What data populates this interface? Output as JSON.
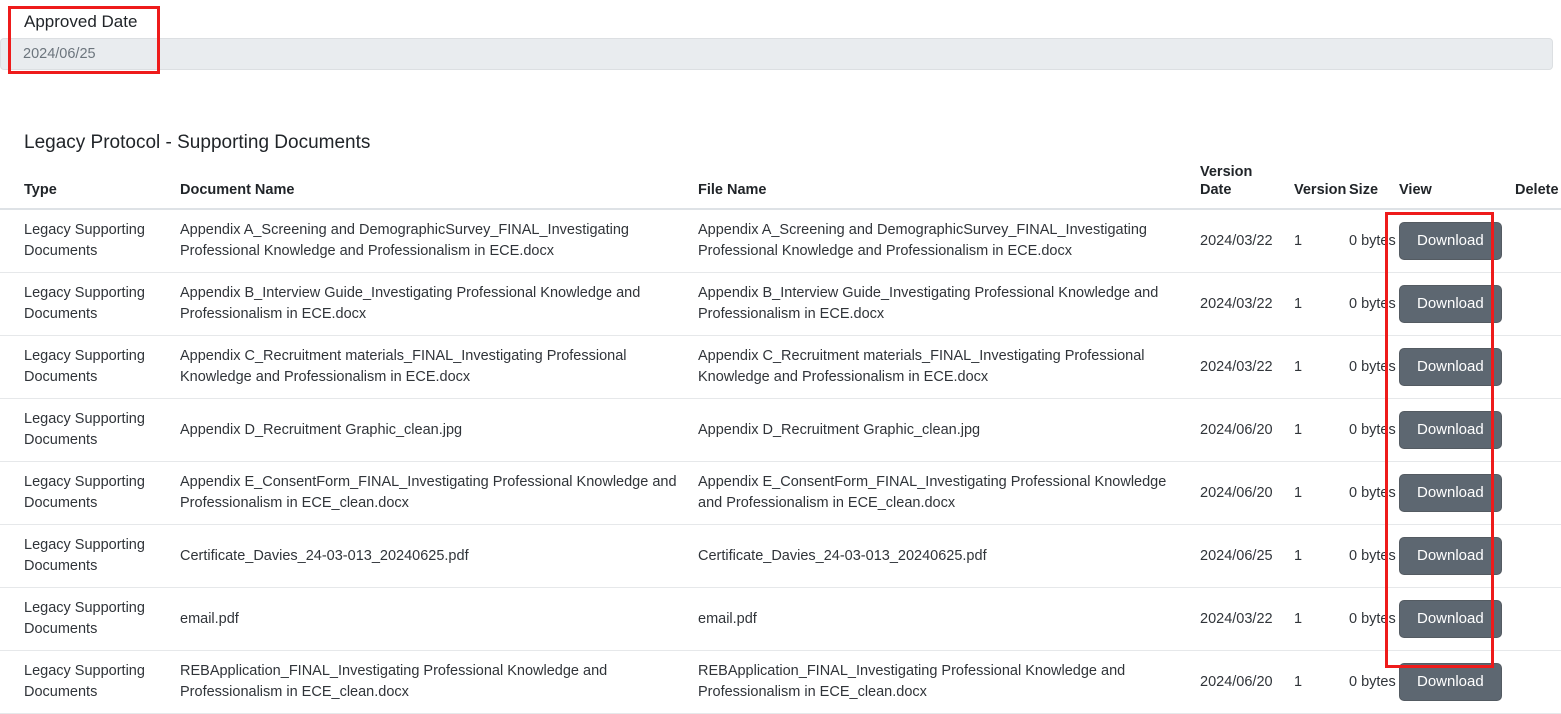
{
  "approved": {
    "label": "Approved Date",
    "value": "2024/06/25"
  },
  "section": {
    "title": "Legacy Protocol - Supporting Documents"
  },
  "table": {
    "headers": {
      "type": "Type",
      "document_name": "Document Name",
      "file_name": "File Name",
      "version_date_line1": "Version",
      "version_date_line2": "Date",
      "version": "Version",
      "size": "Size",
      "view": "View",
      "delete": "Delete"
    },
    "download_label": "Download",
    "rows": [
      {
        "type": "Legacy Supporting Documents",
        "document_name": "Appendix A_Screening and DemographicSurvey_FINAL_Investigating Professional Knowledge and Professionalism in ECE.docx",
        "file_name": "Appendix A_Screening and DemographicSurvey_FINAL_Investigating Professional Knowledge and Professionalism in ECE.docx",
        "version_date": "2024/03/22",
        "version": "1",
        "size": "0 bytes",
        "view": "Download",
        "delete": ""
      },
      {
        "type": "Legacy Supporting Documents",
        "document_name": "Appendix B_Interview Guide_Investigating Professional Knowledge and Professionalism in ECE.docx",
        "file_name": "Appendix B_Interview Guide_Investigating Professional Knowledge and Professionalism in ECE.docx",
        "version_date": "2024/03/22",
        "version": "1",
        "size": "0 bytes",
        "view": "Download",
        "delete": ""
      },
      {
        "type": "Legacy Supporting Documents",
        "document_name": "Appendix C_Recruitment materials_FINAL_Investigating Professional Knowledge and Professionalism in ECE.docx",
        "file_name": "Appendix C_Recruitment materials_FINAL_Investigating Professional Knowledge and Professionalism in ECE.docx",
        "version_date": "2024/03/22",
        "version": "1",
        "size": "0 bytes",
        "view": "Download",
        "delete": ""
      },
      {
        "type": "Legacy Supporting Documents",
        "document_name": "Appendix D_Recruitment Graphic_clean.jpg",
        "file_name": "Appendix D_Recruitment Graphic_clean.jpg",
        "version_date": "2024/06/20",
        "version": "1",
        "size": "0 bytes",
        "view": "Download",
        "delete": ""
      },
      {
        "type": "Legacy Supporting Documents",
        "document_name": "Appendix E_ConsentForm_FINAL_Investigating Professional Knowledge and Professionalism in ECE_clean.docx",
        "file_name": "Appendix E_ConsentForm_FINAL_Investigating Professional Knowledge and Professionalism in ECE_clean.docx",
        "version_date": "2024/06/20",
        "version": "1",
        "size": "0 bytes",
        "view": "Download",
        "delete": ""
      },
      {
        "type": "Legacy Supporting Documents",
        "document_name": "Certificate_Davies_24-03-013_20240625.pdf",
        "file_name": "Certificate_Davies_24-03-013_20240625.pdf",
        "version_date": "2024/06/25",
        "version": "1",
        "size": "0 bytes",
        "view": "Download",
        "delete": ""
      },
      {
        "type": "Legacy Supporting Documents",
        "document_name": "email.pdf",
        "file_name": "email.pdf",
        "version_date": "2024/03/22",
        "version": "1",
        "size": "0 bytes",
        "view": "Download",
        "delete": ""
      },
      {
        "type": "Legacy Supporting Documents",
        "document_name": "REBApplication_FINAL_Investigating Professional Knowledge and Professionalism in ECE_clean.docx",
        "file_name": "REBApplication_FINAL_Investigating Professional Knowledge and Professionalism in ECE_clean.docx",
        "version_date": "2024/06/20",
        "version": "1",
        "size": "0 bytes",
        "view": "Download",
        "delete": ""
      }
    ]
  },
  "annotations": {
    "highlight_color": "#ee1b1b",
    "approved_date_highlight": "Approved Date",
    "download_column_highlight": "View"
  }
}
